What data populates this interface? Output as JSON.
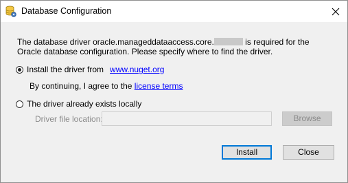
{
  "window": {
    "title": "Database Configuration",
    "close_glyph": "✕"
  },
  "description": {
    "text_before": "The database driver oracle.manageddataaccess.core.",
    "text_after": " is required for the Oracle database configuration. Please specify where to find the driver."
  },
  "option_install": {
    "label": "Install the driver from",
    "link": "www.nuget.org",
    "checked": true,
    "consent_text": "By continuing, I agree to the",
    "consent_link": "license terms"
  },
  "option_local": {
    "label": "The driver already exists locally",
    "checked": false,
    "file_label": "Driver file location:",
    "file_value": "",
    "browse_label": "Browse"
  },
  "buttons": {
    "install": "Install",
    "close": "Close"
  },
  "colors": {
    "link": "#0000ff",
    "default_button_border": "#0078d7"
  }
}
